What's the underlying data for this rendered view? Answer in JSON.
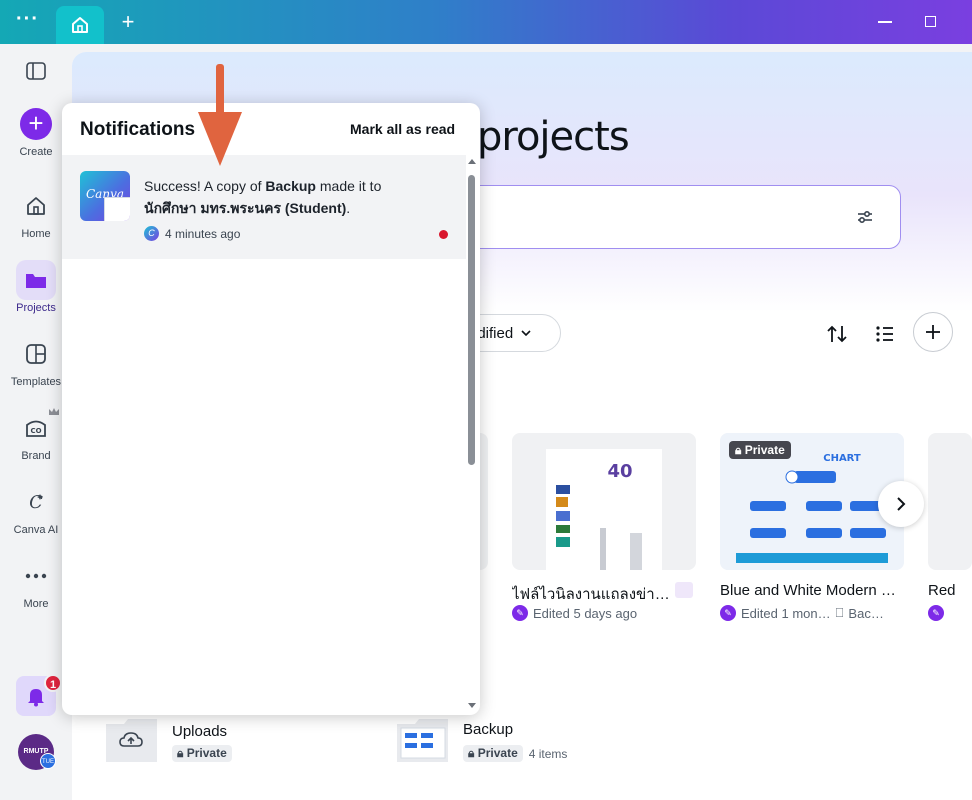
{
  "titlebar": {
    "home_tab": "home-icon"
  },
  "sidebar": {
    "items": [
      {
        "label": "Create",
        "icon": "plus-icon"
      },
      {
        "label": "Home",
        "icon": "home-icon"
      },
      {
        "label": "Projects",
        "icon": "folder-icon"
      },
      {
        "label": "Templates",
        "icon": "templates-icon"
      },
      {
        "label": "Brand",
        "icon": "brand-icon"
      },
      {
        "label": "Canva AI",
        "icon": "canva-ai-icon"
      },
      {
        "label": "More",
        "icon": "more-icon"
      }
    ],
    "notification_count": "1",
    "avatar_text": "RMUTP",
    "avatar_badge": "TUE"
  },
  "main": {
    "title": "projects",
    "sort_label": "odified",
    "cards": [
      {
        "title": "ไฟล์ไวนิลงานแถลงข่า…",
        "meta": "Edited 5 days ago"
      },
      {
        "title": "Blue and White Modern …",
        "meta": "Edited 1 mon…",
        "folder": "Bac…",
        "tag": "Private"
      },
      {
        "title": "Red",
        "meta": ""
      }
    ],
    "folders": [
      {
        "name": "Uploads",
        "tag": "Private",
        "count": ""
      },
      {
        "name": "Backup",
        "tag": "Private",
        "count": "4 items"
      }
    ]
  },
  "notifications": {
    "title": "Notifications",
    "mark_all": "Mark all as read",
    "items": [
      {
        "prefix": "Success! A copy of ",
        "design": "Backup",
        "middle": " made it to ",
        "team": "นักศึกษา มทร.พระนคร (Student)",
        "suffix": ".",
        "time": "4 minutes ago",
        "thumb_text": "Canva",
        "unread": true
      }
    ]
  },
  "colors": {
    "accent": "#7d2ae8",
    "arrow": "#e0643f",
    "unread": "#d9162d"
  }
}
